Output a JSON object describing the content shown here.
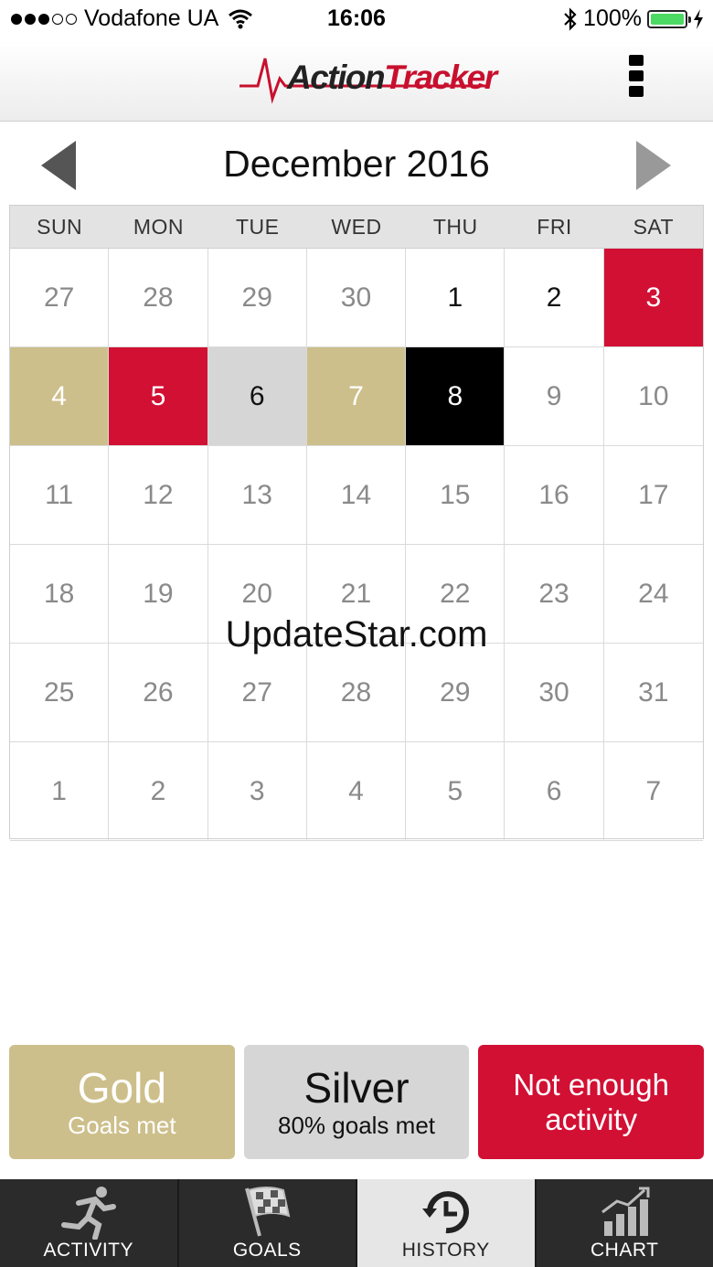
{
  "status_bar": {
    "carrier": "Vodafone UA",
    "time": "16:06",
    "battery": "100%",
    "battery_fill": 1.0
  },
  "header": {
    "logo": {
      "first": "Action",
      "second": "Tracker"
    },
    "icons": [
      "heartbeat-pulse-icon",
      "kebab-menu-icon"
    ]
  },
  "calendar": {
    "month_title": "December 2016",
    "weekdays": [
      "SUN",
      "MON",
      "TUE",
      "WED",
      "THU",
      "FRI",
      "SAT"
    ],
    "days": [
      {
        "n": "27",
        "t": "other"
      },
      {
        "n": "28",
        "t": "other"
      },
      {
        "n": "29",
        "t": "other"
      },
      {
        "n": "30",
        "t": "other"
      },
      {
        "n": "1",
        "t": "cur"
      },
      {
        "n": "2",
        "t": "cur"
      },
      {
        "n": "3",
        "t": "red"
      },
      {
        "n": "4",
        "t": "gold"
      },
      {
        "n": "5",
        "t": "red"
      },
      {
        "n": "6",
        "t": "silver"
      },
      {
        "n": "7",
        "t": "gold"
      },
      {
        "n": "8",
        "t": "black"
      },
      {
        "n": "9",
        "t": "other"
      },
      {
        "n": "10",
        "t": "other"
      },
      {
        "n": "11",
        "t": "other"
      },
      {
        "n": "12",
        "t": "other"
      },
      {
        "n": "13",
        "t": "other"
      },
      {
        "n": "14",
        "t": "other"
      },
      {
        "n": "15",
        "t": "other"
      },
      {
        "n": "16",
        "t": "other"
      },
      {
        "n": "17",
        "t": "other"
      },
      {
        "n": "18",
        "t": "other"
      },
      {
        "n": "19",
        "t": "other"
      },
      {
        "n": "20",
        "t": "other"
      },
      {
        "n": "21",
        "t": "other"
      },
      {
        "n": "22",
        "t": "other"
      },
      {
        "n": "23",
        "t": "other"
      },
      {
        "n": "24",
        "t": "other"
      },
      {
        "n": "25",
        "t": "other"
      },
      {
        "n": "26",
        "t": "other"
      },
      {
        "n": "27",
        "t": "other"
      },
      {
        "n": "28",
        "t": "other"
      },
      {
        "n": "29",
        "t": "other"
      },
      {
        "n": "30",
        "t": "other"
      },
      {
        "n": "31",
        "t": "other"
      },
      {
        "n": "1",
        "t": "other"
      },
      {
        "n": "2",
        "t": "other"
      },
      {
        "n": "3",
        "t": "other"
      },
      {
        "n": "4",
        "t": "other"
      },
      {
        "n": "5",
        "t": "other"
      },
      {
        "n": "6",
        "t": "other"
      },
      {
        "n": "7",
        "t": "other"
      }
    ]
  },
  "watermark": "UpdateStar.com",
  "legend": {
    "gold_title": "Gold",
    "gold_sub": "Goals met",
    "silver_title": "Silver",
    "silver_sub": "80% goals met",
    "red_line1": "Not enough",
    "red_line2": "activity"
  },
  "tabs": [
    {
      "label": "ACTIVITY",
      "icon": "running-person-icon",
      "active": false
    },
    {
      "label": "GOALS",
      "icon": "checkered-flag-icon",
      "active": false
    },
    {
      "label": "HISTORY",
      "icon": "history-clock-icon",
      "active": true
    },
    {
      "label": "CHART",
      "icon": "bar-chart-icon",
      "active": false
    }
  ],
  "colors": {
    "red": "#d21034",
    "gold": "#cdbf8b",
    "silver": "#d6d6d6",
    "black": "#000000",
    "tab_bar": "#2b2b2b"
  }
}
